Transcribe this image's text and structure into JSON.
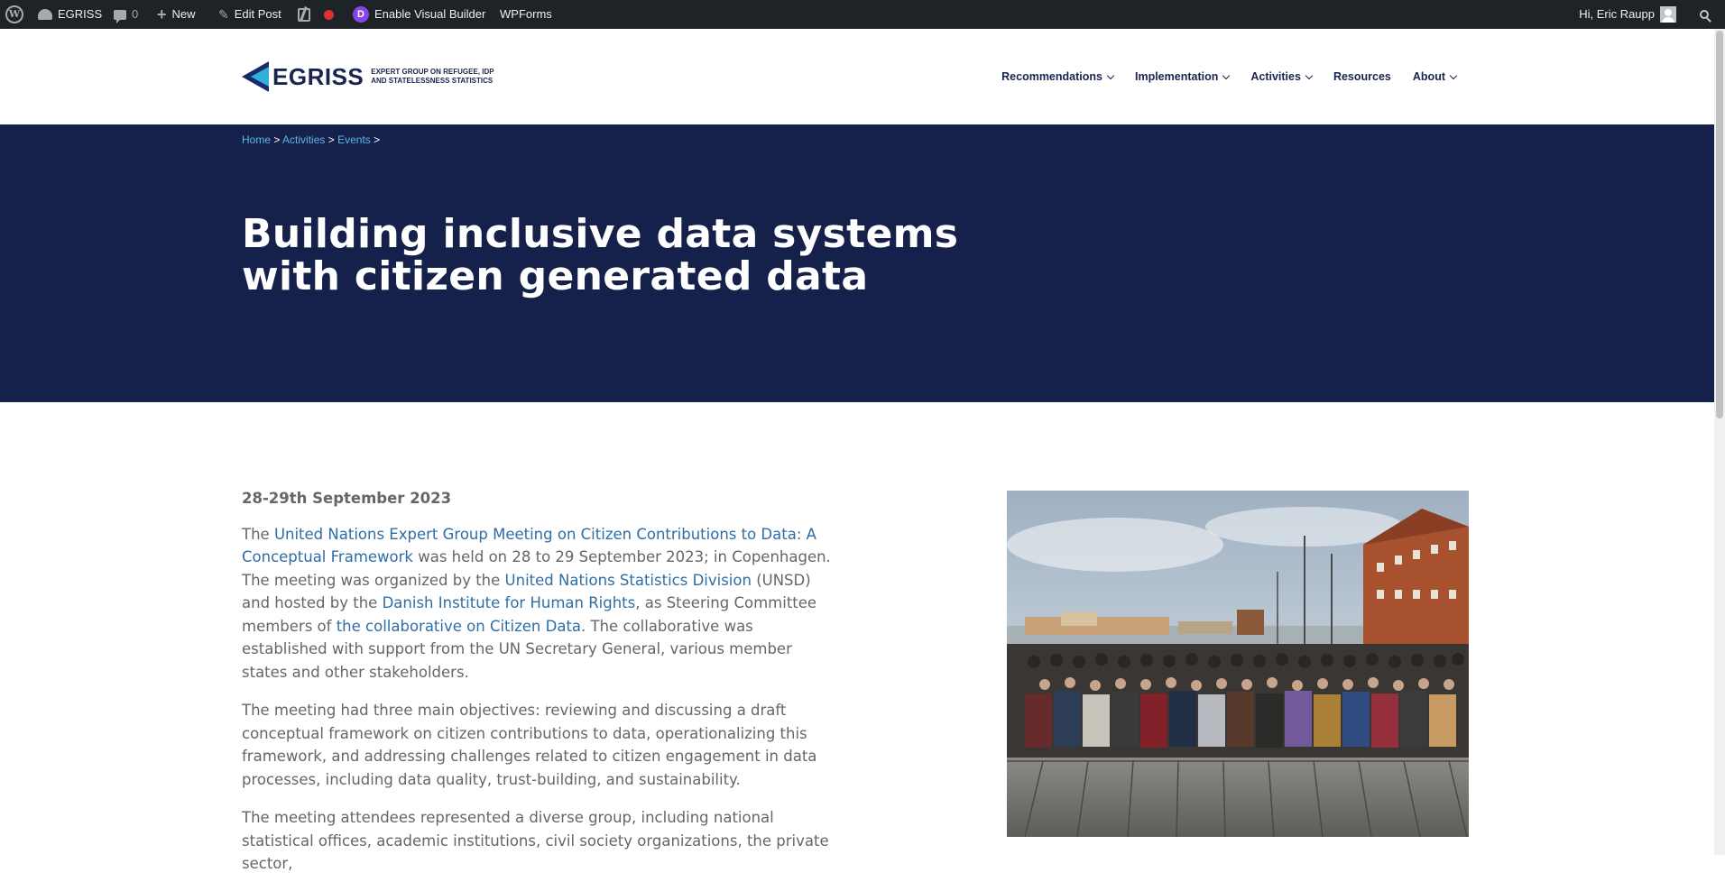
{
  "admin_bar": {
    "site_name": "EGRISS",
    "comments_count": "0",
    "new_label": "New",
    "edit_post_label": "Edit Post",
    "visual_builder_label": "Enable Visual Builder",
    "divi_letter": "D",
    "wpforms_label": "WPForms",
    "greeting": "Hi, Eric Raupp"
  },
  "header": {
    "logo_text": "EGRISS",
    "logo_tagline_1": "EXPERT GROUP ON REFUGEE, IDP",
    "logo_tagline_2": "AND STATELESSNESS STATISTICS",
    "nav": [
      {
        "label": "Recommendations"
      },
      {
        "label": "Implementation"
      },
      {
        "label": "Activities"
      },
      {
        "label": "Resources"
      },
      {
        "label": "About"
      }
    ]
  },
  "breadcrumb": {
    "home": "Home",
    "activities": "Activities",
    "events": "Events",
    "sep": ">"
  },
  "page": {
    "title": "Building inclusive data systems with citizen generated data",
    "date": "28-29th September 2023",
    "p1": {
      "t1": "The ",
      "link1": "United Nations Expert Group Meeting on Citizen Contributions to Data: A Conceptual Framework",
      "t2": " was held on 28 to 29 September 2023; in Copenhagen. The meeting was organized by the ",
      "link2": "United Nations Statistics Division",
      "t3": " (UNSD) and hosted by the ",
      "link3": "Danish Institute for Human Rights",
      "t4": ", as Steering Committee members of ",
      "link4": "the collaborative on Citizen Data",
      "t5": ". The collaborative was established with support from the UN Secretary General, various member states and other stakeholders."
    },
    "p2": "The meeting had three main objectives: reviewing and discussing a draft conceptual framework on citizen contributions to data, operationalizing this framework, and addressing challenges related to citizen engagement in data processes, including data quality, trust-building, and sustainability.",
    "p3": "The meeting attendees represented a diverse group, including national statistical offices, academic institutions, civil society organizations, the private sector,"
  },
  "colors": {
    "hero_bg": "#15204b",
    "link": "#2e6ea6",
    "breadcrumb_link": "#5ab9e6",
    "admin_bar_bg": "#1d2327"
  }
}
